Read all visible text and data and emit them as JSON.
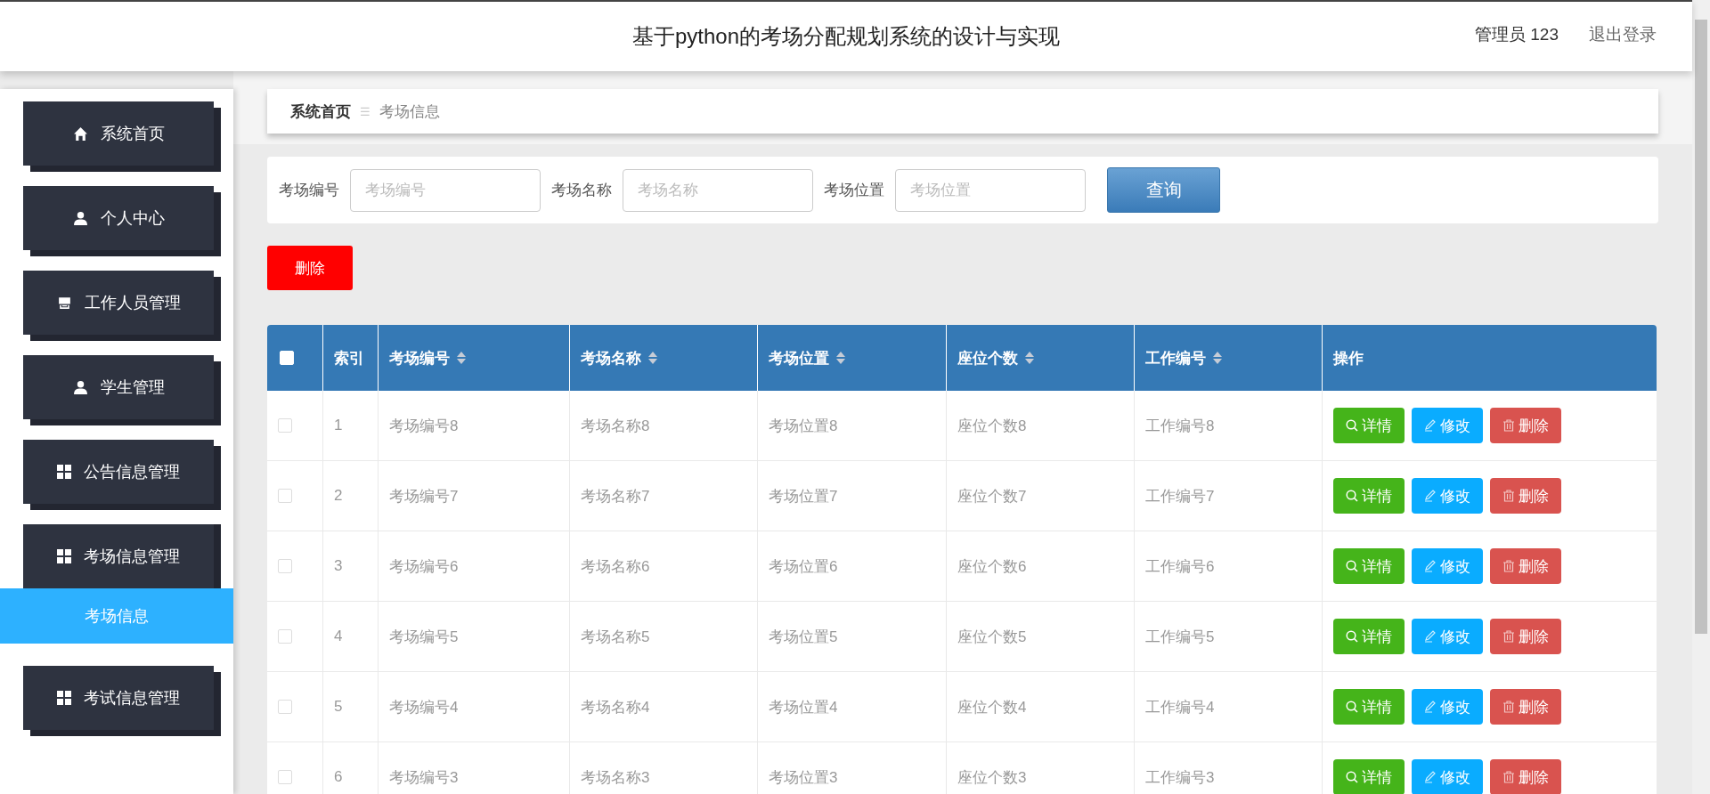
{
  "header": {
    "title": "基于python的考场分配规划系统的设计与实现",
    "user": "管理员 123",
    "logout": "退出登录"
  },
  "sidebar": {
    "items": [
      {
        "label": "系统首页",
        "kind": "home",
        "expanded": false
      },
      {
        "label": "个人中心",
        "kind": "person",
        "expanded": false
      },
      {
        "label": "工作人员管理",
        "kind": "store",
        "expanded": false
      },
      {
        "label": "学生管理",
        "kind": "person",
        "expanded": false
      },
      {
        "label": "公告信息管理",
        "kind": "grid",
        "expanded": false
      },
      {
        "label": "考场信息管理",
        "kind": "grid",
        "expanded": true,
        "children": [
          {
            "label": "考场信息",
            "selected": true
          }
        ]
      },
      {
        "label": "考试信息管理",
        "kind": "grid",
        "expanded": false
      }
    ]
  },
  "breadcrumb": {
    "home": "系统首页",
    "separator": "☰",
    "current": "考场信息"
  },
  "search": {
    "fields": [
      {
        "label": "考场编号",
        "placeholder": "考场编号"
      },
      {
        "label": "考场名称",
        "placeholder": "考场名称"
      },
      {
        "label": "考场位置",
        "placeholder": "考场位置"
      }
    ],
    "button": "查询"
  },
  "bulk_delete": "删除",
  "table": {
    "select_all_checked": false,
    "columns": [
      {
        "label": "索引",
        "sortable": false
      },
      {
        "label": "考场编号",
        "sortable": true
      },
      {
        "label": "考场名称",
        "sortable": true
      },
      {
        "label": "考场位置",
        "sortable": true
      },
      {
        "label": "座位个数",
        "sortable": true
      },
      {
        "label": "工作编号",
        "sortable": true
      },
      {
        "label": "操作",
        "sortable": false
      }
    ],
    "rows": [
      {
        "checked": false,
        "cells": [
          "1",
          "考场编号8",
          "考场名称8",
          "考场位置8",
          "座位个数8",
          "工作编号8"
        ],
        "actions": [
          {
            "kind": "detail",
            "label": "详情"
          },
          {
            "kind": "edit",
            "label": "修改"
          },
          {
            "kind": "delete",
            "label": "删除"
          }
        ]
      },
      {
        "checked": false,
        "cells": [
          "2",
          "考场编号7",
          "考场名称7",
          "考场位置7",
          "座位个数7",
          "工作编号7"
        ],
        "actions": [
          {
            "kind": "detail",
            "label": "详情"
          },
          {
            "kind": "edit",
            "label": "修改"
          },
          {
            "kind": "delete",
            "label": "删除"
          }
        ]
      },
      {
        "checked": false,
        "cells": [
          "3",
          "考场编号6",
          "考场名称6",
          "考场位置6",
          "座位个数6",
          "工作编号6"
        ],
        "actions": [
          {
            "kind": "detail",
            "label": "详情"
          },
          {
            "kind": "edit",
            "label": "修改"
          },
          {
            "kind": "delete",
            "label": "删除"
          }
        ]
      },
      {
        "checked": false,
        "cells": [
          "4",
          "考场编号5",
          "考场名称5",
          "考场位置5",
          "座位个数5",
          "工作编号5"
        ],
        "actions": [
          {
            "kind": "detail",
            "label": "详情"
          },
          {
            "kind": "edit",
            "label": "修改"
          },
          {
            "kind": "delete",
            "label": "删除"
          }
        ]
      },
      {
        "checked": false,
        "cells": [
          "5",
          "考场编号4",
          "考场名称4",
          "考场位置4",
          "座位个数4",
          "工作编号4"
        ],
        "actions": [
          {
            "kind": "detail",
            "label": "详情"
          },
          {
            "kind": "edit",
            "label": "修改"
          },
          {
            "kind": "delete",
            "label": "删除"
          }
        ]
      },
      {
        "checked": false,
        "cells": [
          "6",
          "考场编号3",
          "考场名称3",
          "考场位置3",
          "座位个数3",
          "工作编号3"
        ],
        "actions": [
          {
            "kind": "detail",
            "label": "详情"
          },
          {
            "kind": "edit",
            "label": "修改"
          },
          {
            "kind": "delete",
            "label": "删除"
          }
        ]
      }
    ]
  }
}
